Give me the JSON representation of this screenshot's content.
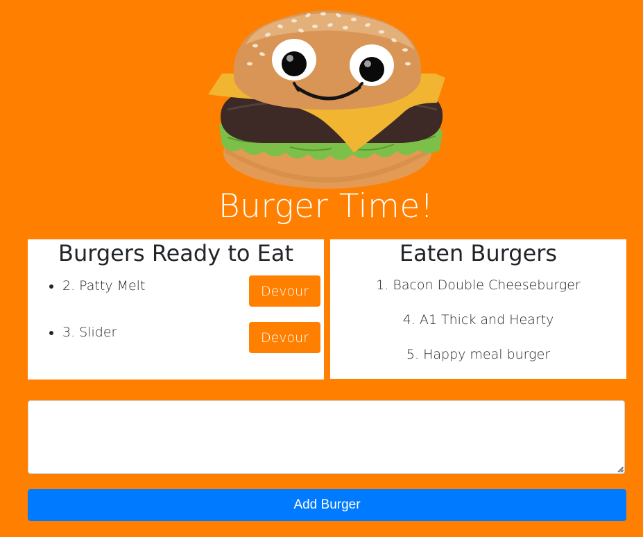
{
  "header": {
    "logo_icon": "smiling-burger-icon",
    "title": "Burger Time!"
  },
  "ready_panel": {
    "heading": "Burgers Ready to Eat",
    "items": [
      {
        "label": "2. Patty Melt",
        "button_label": "Devour"
      },
      {
        "label": "3. Slider",
        "button_label": "Devour"
      }
    ]
  },
  "eaten_panel": {
    "heading": "Eaten Burgers",
    "items": [
      "1. Bacon Double Cheeseburger",
      "4. A1 Thick and Hearty",
      "5. Happy meal burger"
    ]
  },
  "form": {
    "input_value": "",
    "submit_label": "Add Burger"
  },
  "colors": {
    "background": "#ff7f00",
    "accent_button": "#ff7f00",
    "primary_button": "#007bff",
    "panel": "#ffffff"
  }
}
